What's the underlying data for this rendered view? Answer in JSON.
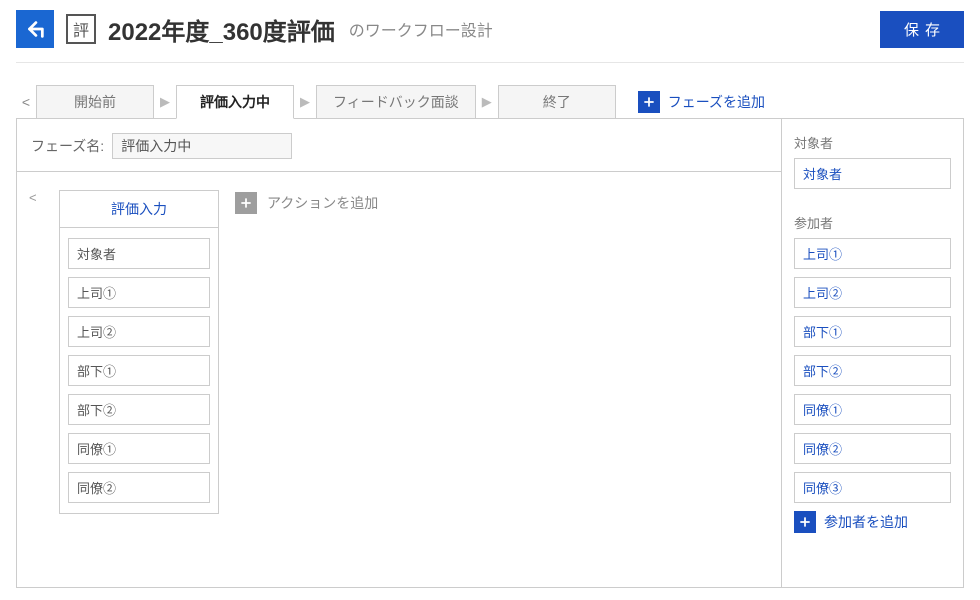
{
  "header": {
    "app_icon_char": "評",
    "title": "2022年度_360度評価",
    "subtitle": "のワークフロー設計",
    "save_label": "保存"
  },
  "tabs": [
    {
      "label": "開始前",
      "active": false
    },
    {
      "label": "評価入力中",
      "active": true
    },
    {
      "label": "フィードバック面談",
      "active": false
    },
    {
      "label": "終了",
      "active": false
    }
  ],
  "add_phase_label": "フェーズを追加",
  "phase_name_label": "フェーズ名:",
  "phase_name_value": "評価入力中",
  "action_card": {
    "title": "評価入力",
    "participants": [
      "対象者",
      "上司①",
      "上司②",
      "部下①",
      "部下②",
      "同僚①",
      "同僚②"
    ]
  },
  "add_action_label": "アクションを追加",
  "right": {
    "target_label": "対象者",
    "target_items": [
      "対象者"
    ],
    "participants_label": "参加者",
    "participant_items": [
      "上司①",
      "上司②",
      "部下①",
      "部下②",
      "同僚①",
      "同僚②",
      "同僚③"
    ],
    "add_participant_label": "参加者を追加"
  },
  "colors": {
    "primary": "#1a4fbf",
    "back": "#1a67d2"
  }
}
